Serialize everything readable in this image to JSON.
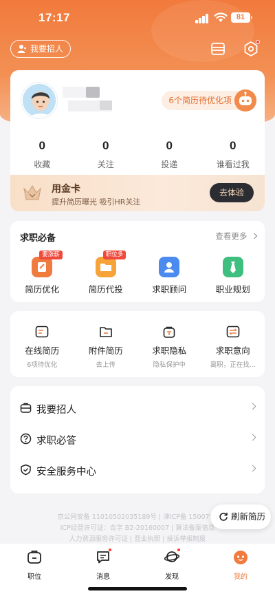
{
  "status": {
    "time": "17:17",
    "battery": "81"
  },
  "header": {
    "recruit_label": "我要招人"
  },
  "profile": {
    "optimize_label": "6个简历待优化项",
    "stats": [
      {
        "num": "0",
        "label": "收藏"
      },
      {
        "num": "0",
        "label": "关注"
      },
      {
        "num": "0",
        "label": "投递"
      },
      {
        "num": "0",
        "label": "谁看过我"
      }
    ],
    "gold": {
      "title": "用金卡",
      "subtitle": "提升简历曝光 吸引HR关注",
      "button": "去体验"
    }
  },
  "essentials": {
    "title": "求职必备",
    "more": "查看更多",
    "items": [
      {
        "label": "简历优化",
        "tag": "要涨薪",
        "color": "#f07b3f"
      },
      {
        "label": "简历代投",
        "tag": "职位多",
        "color": "#f6a43a"
      },
      {
        "label": "求职顾问",
        "tag": "",
        "color": "#4b8bef"
      },
      {
        "label": "职业规划",
        "tag": "",
        "color": "#3fbf7f"
      }
    ]
  },
  "resume_tools": [
    {
      "label": "在线简历",
      "sub": "6项待优化"
    },
    {
      "label": "附件简历",
      "sub": "去上传"
    },
    {
      "label": "求职隐私",
      "sub": "隐私保护中"
    },
    {
      "label": "求职意向",
      "sub": "离职，正在找..."
    }
  ],
  "menu": [
    {
      "label": "我要招人"
    },
    {
      "label": "求职必答"
    },
    {
      "label": "安全服务中心"
    }
  ],
  "legal": {
    "line1": "京公网安备 11010502035189号 | 津ICP备 1500798",
    "line2": "ICP经营许可证：合字 B2-20160007 | 算法备案信息",
    "line3": "人力资源服务许可证 | 营业执照 | 投诉举报制度"
  },
  "refresh_label": "刷新简历",
  "tabs": [
    {
      "label": "职位"
    },
    {
      "label": "消息"
    },
    {
      "label": "发现"
    },
    {
      "label": "我的"
    }
  ],
  "colors": {
    "accent": "#f17a3c",
    "tag_red": "#f04a3c"
  }
}
